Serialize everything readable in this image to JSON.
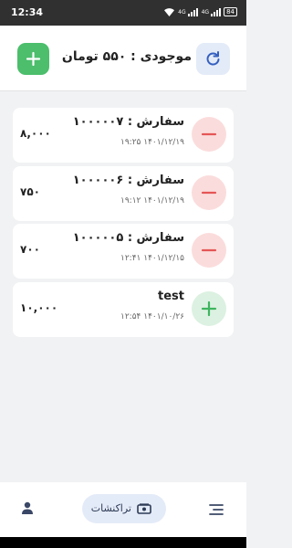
{
  "status": {
    "time": "12:34",
    "network_1": "4G",
    "network_2": "4G",
    "battery": "84"
  },
  "header": {
    "balance_title": "موجودی : ۵۵۰ تومان",
    "add_icon": "plus-icon",
    "refresh_icon": "refresh-icon"
  },
  "transactions": [
    {
      "title": "سفارش : ۱۰۰۰۰۰۷",
      "date": "۱۴۰۱/۱۲/۱۹  ۱۹:۲۵",
      "amount": "۸,۰۰۰",
      "type": "minus"
    },
    {
      "title": "سفارش : ۱۰۰۰۰۰۶",
      "date": "۱۴۰۱/۱۲/۱۹  ۱۹:۱۲",
      "amount": "۷۵۰",
      "type": "minus"
    },
    {
      "title": "سفارش : ۱۰۰۰۰۰۵",
      "date": "۱۴۰۱/۱۲/۱۵  ۱۲:۴۱",
      "amount": "۷۰۰",
      "type": "minus"
    },
    {
      "title": "test",
      "date": "۱۴۰۱/۱۰/۲۶  ۱۲:۵۴",
      "amount": "۱۰,۰۰۰",
      "type": "plus"
    }
  ],
  "bottom_nav": {
    "active_label": "تراکنشات",
    "items": [
      "person-icon",
      "transactions-icon",
      "menu-icon"
    ]
  },
  "colors": {
    "accent_green": "#4cbe6c",
    "accent_blue": "#e4ebf8",
    "minus_red": "#e55656",
    "plus_green": "#3fb55f"
  }
}
